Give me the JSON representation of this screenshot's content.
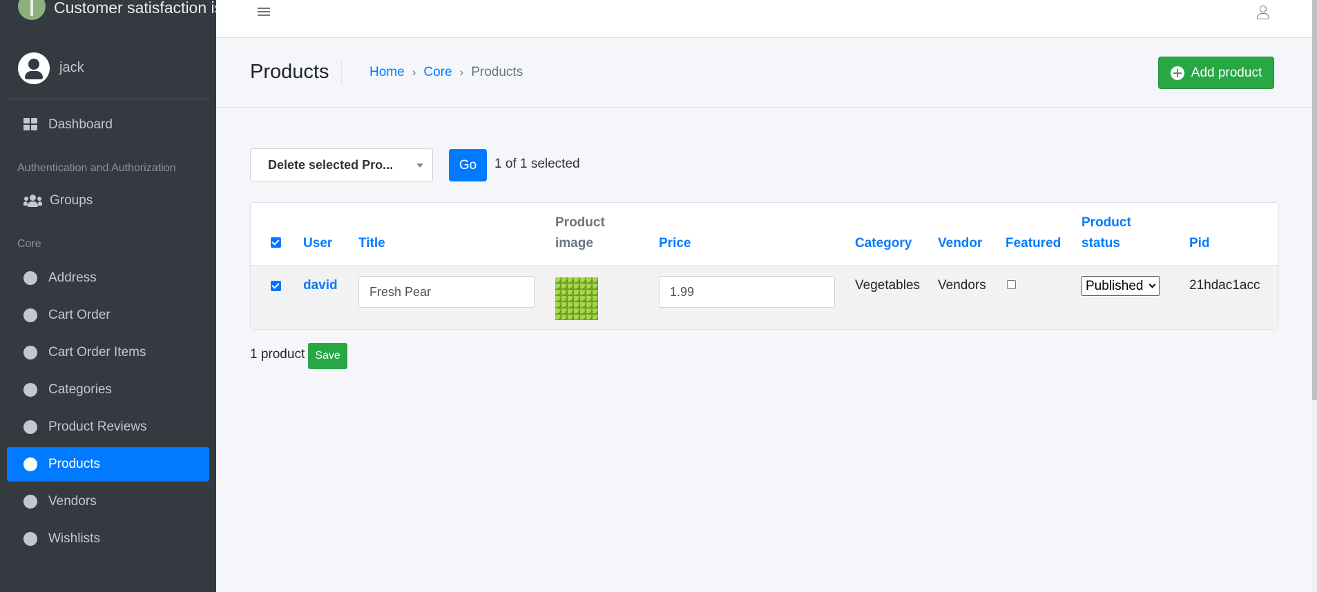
{
  "app": {
    "brand": "Customer satisfaction is"
  },
  "user": {
    "name": "jack"
  },
  "sidebar": {
    "dashboard": "Dashboard",
    "section_auth": "Authentication and Authorization",
    "groups": "Groups",
    "section_core": "Core",
    "items": [
      {
        "label": "Address"
      },
      {
        "label": "Cart Order"
      },
      {
        "label": "Cart Order Items"
      },
      {
        "label": "Categories"
      },
      {
        "label": "Product Reviews"
      },
      {
        "label": "Products",
        "active": true
      },
      {
        "label": "Vendors"
      },
      {
        "label": "Wishlists"
      }
    ]
  },
  "header": {
    "title": "Products",
    "breadcrumb": [
      "Home",
      "Core",
      "Products"
    ],
    "breadcrumb_sep": "›",
    "add_button": "Add product"
  },
  "actions": {
    "selected_action": "Delete selected Pro...",
    "go_label": "Go",
    "selection_text": "1 of 1 selected"
  },
  "table": {
    "columns": {
      "user": "User",
      "title": "Title",
      "product_image_1": "Product",
      "product_image_2": "image",
      "price": "Price",
      "category": "Category",
      "vendor": "Vendor",
      "featured": "Featured",
      "status_1": "Product",
      "status_2": "status",
      "pid": "Pid"
    },
    "rows": [
      {
        "selected": true,
        "user": "david",
        "title": "Fresh Pear",
        "price": "1.99",
        "category": "Vegetables",
        "vendor": "Vendors",
        "featured": false,
        "status": "Published",
        "pid": "21hdac1acc"
      }
    ]
  },
  "footer": {
    "count": "1 product",
    "save_label": "Save"
  },
  "colors": {
    "sidebar_bg": "#343a40",
    "primary": "#007bff",
    "success": "#28a745"
  }
}
